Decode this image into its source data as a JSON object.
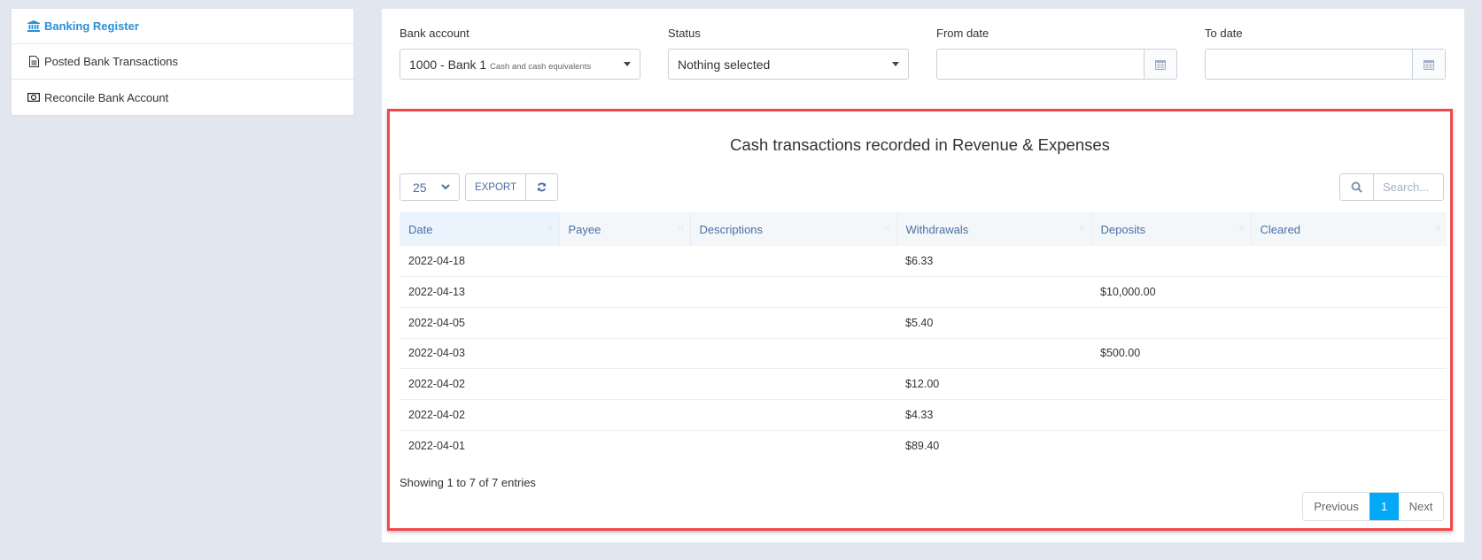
{
  "sidebar": {
    "items": [
      {
        "label": "Banking Register",
        "icon": "bank-icon",
        "active": true
      },
      {
        "label": "Posted Bank Transactions",
        "icon": "document-icon",
        "active": false
      },
      {
        "label": "Reconcile Bank Account",
        "icon": "money-icon",
        "active": false
      }
    ]
  },
  "filters": {
    "bank_account": {
      "label": "Bank account",
      "value": "1000 - Bank 1",
      "sub": "Cash and cash equivalents"
    },
    "status": {
      "label": "Status",
      "value": "Nothing selected"
    },
    "from_date": {
      "label": "From date",
      "value": ""
    },
    "to_date": {
      "label": "To date",
      "value": ""
    }
  },
  "report": {
    "title": "Cash transactions recorded in Revenue & Expenses",
    "page_length": "25",
    "export_label": "EXPORT",
    "search_placeholder": "Search...",
    "columns": [
      "Date",
      "Payee",
      "Descriptions",
      "Withdrawals",
      "Deposits",
      "Cleared"
    ],
    "rows": [
      [
        "2022-04-18",
        "",
        "",
        "$6.33",
        "",
        ""
      ],
      [
        "2022-04-13",
        "",
        "",
        "",
        "$10,000.00",
        ""
      ],
      [
        "2022-04-05",
        "",
        "",
        "$5.40",
        "",
        ""
      ],
      [
        "2022-04-03",
        "",
        "",
        "",
        "$500.00",
        ""
      ],
      [
        "2022-04-02",
        "",
        "",
        "$12.00",
        "",
        ""
      ],
      [
        "2022-04-02",
        "",
        "",
        "$4.33",
        "",
        ""
      ],
      [
        "2022-04-01",
        "",
        "",
        "$89.40",
        "",
        ""
      ]
    ],
    "info": "Showing 1 to 7 of 7 entries",
    "pagination": {
      "previous": "Previous",
      "current": "1",
      "next": "Next"
    }
  },
  "colors": {
    "accent": "#03a9f4",
    "highlight_border": "#f0484c",
    "link": "#2b8fd8"
  }
}
